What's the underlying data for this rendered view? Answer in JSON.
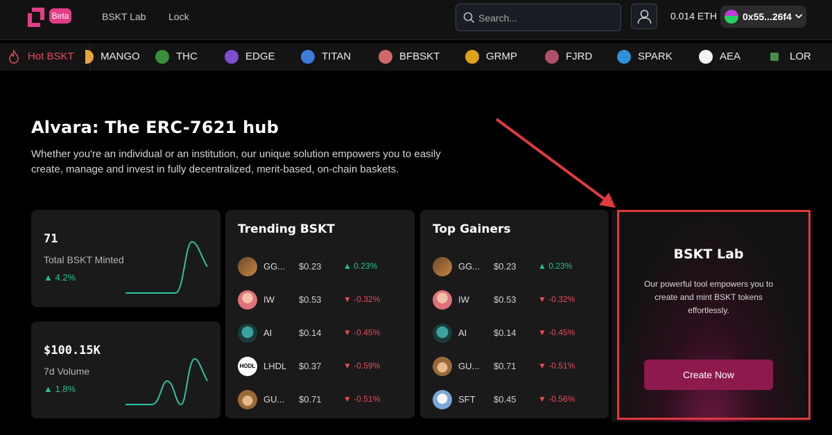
{
  "nav": {
    "beta_label": "Beta",
    "links": [
      "BSKT Lab",
      "Lock"
    ],
    "search_placeholder": "Search...",
    "eth_balance": "0.014 ETH",
    "wallet_address": "0x55...26f4"
  },
  "ticker": {
    "hot_label": "Hot BSKT",
    "items": [
      {
        "name": "MANGO",
        "color": "#e8a33a"
      },
      {
        "name": "THC",
        "color": "#3a8f3a"
      },
      {
        "name": "EDGE",
        "color": "#7b4fd0"
      },
      {
        "name": "TITAN",
        "color": "#3c7bd9"
      },
      {
        "name": "BFBSKT",
        "color": "#d06a6a"
      },
      {
        "name": "GRMP",
        "color": "#e0a21a"
      },
      {
        "name": "FJRD",
        "color": "#b0506a"
      },
      {
        "name": "SPARK",
        "color": "#2f8fd8"
      },
      {
        "name": "AEA",
        "color": "#f2f2f2"
      },
      {
        "name": "LOR",
        "color": "#4a8c4a"
      }
    ]
  },
  "hero": {
    "title": "Alvara: The ERC-7621 hub",
    "subtitle": "Whether you're an individual or an institution, our unique solution empowers you to easily create, manage and invest in fully decentralized, merit-based, on-chain baskets."
  },
  "stats": {
    "minted": {
      "value": "71",
      "label": "Total BSKT Minted",
      "change": "▲ 4.2%"
    },
    "volume": {
      "value": "$100.15K",
      "label": "7d Volume",
      "change": "▲ 1.8%"
    }
  },
  "trending": {
    "title": "Trending BSKT",
    "rows": [
      {
        "name": "GG...",
        "price": "$0.23",
        "change": "▲ 0.23%",
        "dir": "up",
        "icon": "gg-icon"
      },
      {
        "name": "IW",
        "price": "$0.53",
        "change": "▼ -0.32%",
        "dir": "down",
        "icon": "iw-icon"
      },
      {
        "name": "AI",
        "price": "$0.14",
        "change": "▼ -0.45%",
        "dir": "down",
        "icon": "ai-icon"
      },
      {
        "name": "LHDL",
        "price": "$0.37",
        "change": "▼ -0.59%",
        "dir": "down",
        "icon": "hodl-icon"
      },
      {
        "name": "GU...",
        "price": "$0.71",
        "change": "▼ -0.51%",
        "dir": "down",
        "icon": "gu-icon"
      }
    ]
  },
  "gainers": {
    "title": "Top Gainers",
    "rows": [
      {
        "name": "GG...",
        "price": "$0.23",
        "change": "▲ 0.23%",
        "dir": "up",
        "icon": "gg-icon"
      },
      {
        "name": "IW",
        "price": "$0.53",
        "change": "▼ -0.32%",
        "dir": "down",
        "icon": "iw-icon"
      },
      {
        "name": "AI",
        "price": "$0.14",
        "change": "▼ -0.45%",
        "dir": "down",
        "icon": "ai-icon"
      },
      {
        "name": "GU...",
        "price": "$0.71",
        "change": "▼ -0.51%",
        "dir": "down",
        "icon": "gu-icon"
      },
      {
        "name": "SFT",
        "price": "$0.45",
        "change": "▼ -0.56%",
        "dir": "down",
        "icon": "sft-icon"
      }
    ]
  },
  "lab": {
    "title": "BSKT Lab",
    "description": "Our powerful tool empowers you to create and mint BSKT tokens effortlessly.",
    "button": "Create Now"
  },
  "colors": {
    "accent": "#e23c85",
    "positive": "#25c28a",
    "negative": "#ea4a5a",
    "highlight": "#e03a3e",
    "button": "#8e1a4d"
  }
}
